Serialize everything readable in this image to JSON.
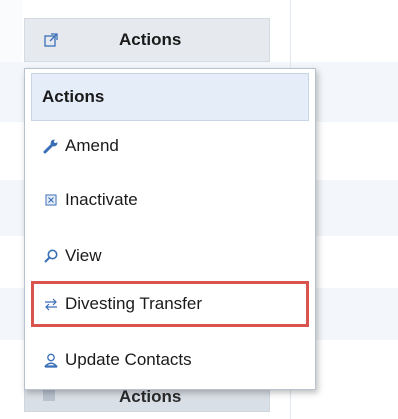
{
  "top_button": {
    "label": "Actions",
    "icon": "external-link-icon"
  },
  "bottom_button": {
    "label": "Actions"
  },
  "dropdown": {
    "header": "Actions",
    "items": [
      {
        "label": "Amend",
        "icon": "wrench-icon"
      },
      {
        "label": "Inactivate",
        "icon": "inactivate-icon"
      },
      {
        "label": "View",
        "icon": "magnifier-icon"
      },
      {
        "label": "Divesting Transfer",
        "icon": "transfer-arrows-icon",
        "highlighted": true
      },
      {
        "label": "Update Contacts",
        "icon": "contact-person-icon"
      }
    ]
  },
  "colors": {
    "highlight_border": "#d9534f",
    "accent": "#3a6fb7",
    "header_bg": "#e5edf8"
  }
}
